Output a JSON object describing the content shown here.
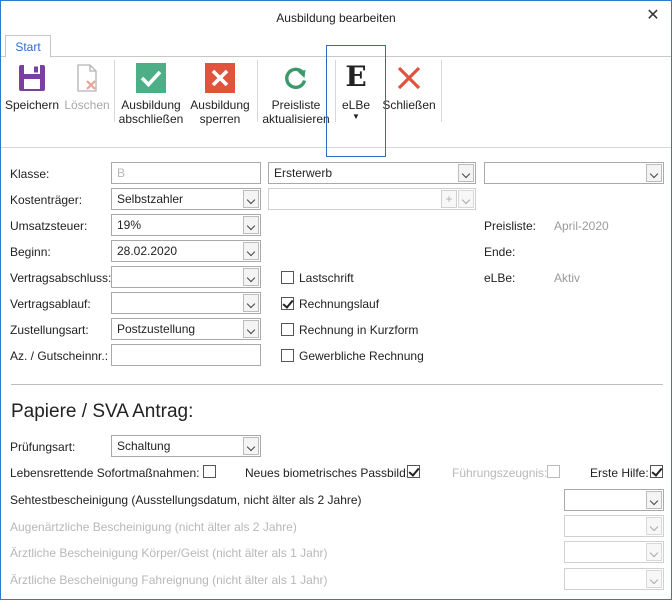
{
  "window": {
    "title": "Ausbildung bearbeiten"
  },
  "tabs": {
    "start": "Start"
  },
  "ribbon": {
    "save": "Speichern",
    "delete": "Löschen",
    "complete_l1": "Ausbildung",
    "complete_l2": "abschließen",
    "lock_l1": "Ausbildung",
    "lock_l2": "sperren",
    "pricelist_l1": "Preisliste",
    "pricelist_l2": "aktualisieren",
    "elbe_letter": "E",
    "elbe": "eLBe",
    "close": "Schließen"
  },
  "colors": {
    "accent": "#2b6cc4",
    "check_green": "#4caf86",
    "cross_red": "#e0533d",
    "save_purple": "#7b3fa0"
  },
  "form": {
    "klasse_label": "Klasse:",
    "klasse_value": "B",
    "erwerb_value": "Ersterwerb",
    "erwerb2_value": "",
    "kostentraeger_label": "Kostenträger:",
    "kostentraeger_value": "Selbstzahler",
    "kostentraeger2_value": "",
    "umsatzsteuer_label": "Umsatzsteuer:",
    "umsatzsteuer_value": "19%",
    "beginn_label": "Beginn:",
    "beginn_value": "28.02.2020",
    "vertragsabschluss_label": "Vertragsabschluss:",
    "vertragsabschluss_value": "",
    "vertragsablauf_label": "Vertragsablauf:",
    "vertragsablauf_value": "",
    "zustellungsart_label": "Zustellungsart:",
    "zustellungsart_value": "Postzustellung",
    "az_label": "Az. / Gutscheinnr.:",
    "az_value": "",
    "lastschrift": "Lastschrift",
    "rechnungslauf": "Rechnungslauf",
    "kurzform": "Rechnung in Kurzform",
    "gewerblich": "Gewerbliche Rechnung",
    "preisliste_label": "Preisliste:",
    "preisliste_value": "April-2020",
    "ende_label": "Ende:",
    "elbe_label": "eLBe:",
    "elbe_value": "Aktiv"
  },
  "sva": {
    "title": "Papiere / SVA Antrag:",
    "pruefungsart_label": "Prüfungsart:",
    "pruefungsart_value": "Schaltung",
    "sofortmassnahmen": "Lebensrettende Sofortmaßnahmen:",
    "passbild": "Neues biometrisches Passbild:",
    "fuehrungszeugnis": "Führungszeugnis:",
    "erste_hilfe": "Erste Hilfe:",
    "sehtest": "Sehtestbescheinigung (Ausstellungsdatum, nicht älter als 2 Jahre)",
    "augenarzt": "Augenärtzliche Bescheinigung (nicht älter als 2 Jahre)",
    "koerper_geist": "Ärztliche Bescheinigung Körper/Geist (nicht älter als 1 Jahr)",
    "fahreignung": "Ärztliche Bescheinigung Fahreignung (nicht älter als 1 Jahr)"
  }
}
